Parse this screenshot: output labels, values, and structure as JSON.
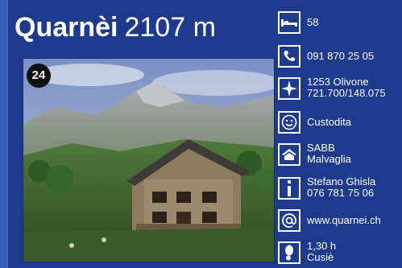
{
  "hut": {
    "name": "Quarnèi",
    "altitude": "2107 m",
    "number": "24"
  },
  "info": {
    "beds": "58",
    "phone": "091 870 25 05",
    "location_line1": "1253 Olivone",
    "location_line2": "721.700/148.075",
    "status": "Custodita",
    "owner_line1": "SABB",
    "owner_line2": "Malvaglia",
    "contact_name": "Stefano Ghisla",
    "contact_phone": "076 781 75 06",
    "website": "www.quarnei.ch",
    "time_line1": "1,30 h",
    "time_line2": "Cusiè"
  },
  "icons": [
    "bed-icon",
    "phone-icon",
    "compass-rose-icon",
    "smiley-icon",
    "hut-roof-icon",
    "info-icon",
    "at-sign-icon",
    "footprint-icon"
  ],
  "colors": {
    "background": "#1d3a8c",
    "text": "#ffffff",
    "left_stripe": "#3a5fb6"
  }
}
